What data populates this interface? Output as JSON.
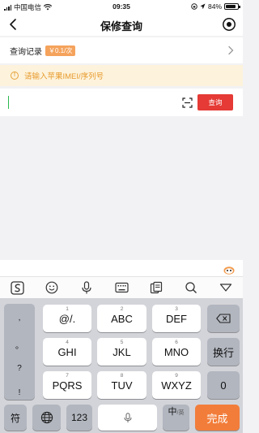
{
  "status_bar": {
    "carrier": "中国电信",
    "time": "09:35",
    "battery": "84%",
    "battery_level": 0.84
  },
  "nav": {
    "title": "保修查询"
  },
  "records": {
    "label": "查询记录",
    "price": "￥0.1/次"
  },
  "notice": {
    "text": "请输入苹果IMEI/序列号"
  },
  "search": {
    "value": "",
    "button_label": "查询"
  },
  "keyboard": {
    "punctuation": [
      ",",
      "。",
      "?",
      "!"
    ],
    "rows": [
      [
        {
          "main": "@/.",
          "sub": "1"
        },
        {
          "main": "ABC",
          "sub": "2"
        },
        {
          "main": "DEF",
          "sub": "3"
        }
      ],
      [
        {
          "main": "GHI",
          "sub": "4"
        },
        {
          "main": "JKL",
          "sub": "5"
        },
        {
          "main": "MNO",
          "sub": "6"
        }
      ],
      [
        {
          "main": "PQRS",
          "sub": "7"
        },
        {
          "main": "TUV",
          "sub": "8"
        },
        {
          "main": "WXYZ",
          "sub": "9"
        }
      ]
    ],
    "newline": "换行",
    "zero": "0",
    "symbols": "符",
    "numbers": "123",
    "lang_main": "中",
    "lang_sub": "/英",
    "done": "完成"
  },
  "colors": {
    "accent_red": "#e53a35",
    "orange": "#f27d3a",
    "notice_text": "#e89a2c",
    "notice_bg": "#fdf3dc"
  }
}
